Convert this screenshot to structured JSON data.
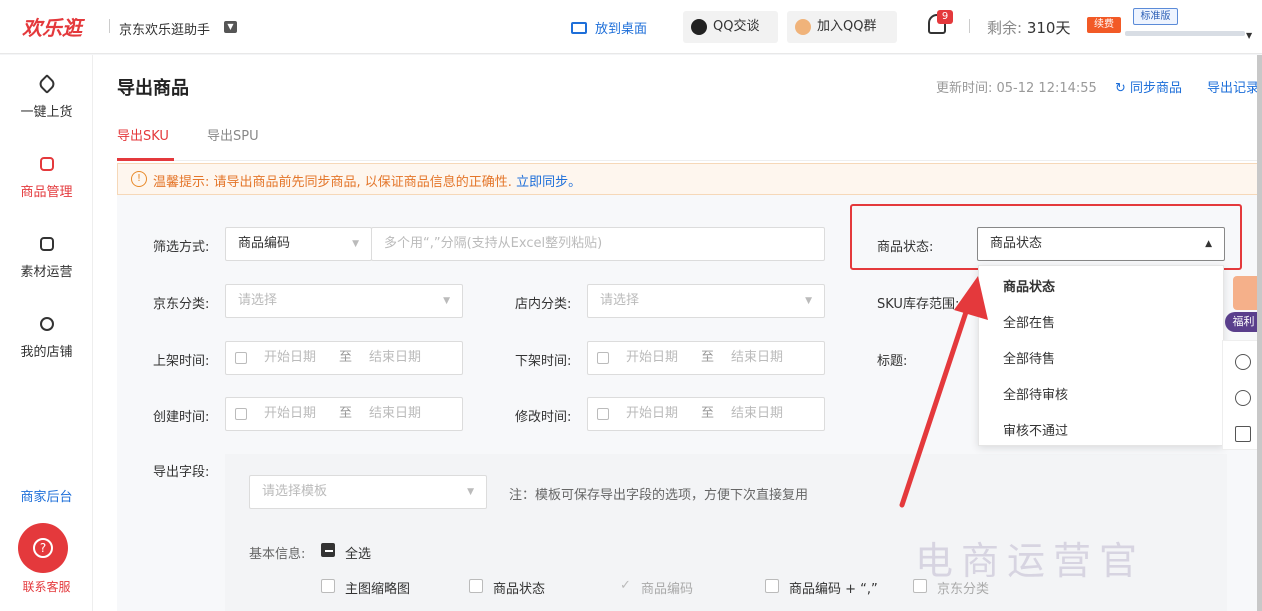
{
  "topbar": {
    "logo": "欢乐逛",
    "app_name": "京东欢乐逛助手",
    "send_to_desktop": "放到桌面",
    "qq_chat": "QQ交谈",
    "join_qq_group": "加入QQ群",
    "notification_count": "9",
    "remaining_label": "剩余:",
    "remaining_value": "310天",
    "renew_badge": "续费",
    "edition_badge": "标准版"
  },
  "sidebar": {
    "items": [
      {
        "label": "一键上货",
        "icon": "tag-icon"
      },
      {
        "label": "商品管理",
        "icon": "bag-icon",
        "active": true
      },
      {
        "label": "素材运营",
        "icon": "image-icon"
      },
      {
        "label": "我的店铺",
        "icon": "store-icon"
      }
    ],
    "merchant_backend": "商家后台",
    "customer_service": "联系客服"
  },
  "main": {
    "title": "导出商品",
    "updated_label": "更新时间: 05-12 12:14:55",
    "sync_link": "同步商品",
    "export_log_link": "导出记录",
    "tabs": [
      "导出SKU",
      "导出SPU"
    ],
    "notice_text": "温馨提示: 请导出商品前先同步商品, 以保证商品信息的正确性.",
    "notice_link": "立即同步。"
  },
  "filters": {
    "filter_method_label": "筛选方式:",
    "filter_method_value": "商品编码",
    "filter_input_placeholder": "多个用“,”分隔(支持从Excel整列粘贴)",
    "status_label": "商品状态:",
    "status_value": "商品状态",
    "jd_category_label": "京东分类:",
    "jd_category_placeholder": "请选择",
    "shop_category_label": "店内分类:",
    "shop_category_placeholder": "请选择",
    "sku_stock_label": "SKU库存范围:",
    "list_time_label": "上架时间:",
    "delist_time_label": "下架时间:",
    "title_label": "标题:",
    "create_time_label": "创建时间:",
    "modify_time_label": "修改时间:",
    "date_start": "开始日期",
    "date_to": "至",
    "date_end": "结束日期"
  },
  "status_dropdown": {
    "options": [
      "商品状态",
      "全部在售",
      "全部待售",
      "全部待审核",
      "审核不通过"
    ]
  },
  "export_fields": {
    "label": "导出字段:",
    "template_placeholder": "请选择模板",
    "template_note": "注：模板可保存导出字段的选项，方便下次直接复用",
    "basic_info_label": "基本信息:",
    "select_all": "全选",
    "fields": [
      "主图缩略图",
      "商品状态",
      "商品编码",
      "商品编码 + “,”",
      "京东分类"
    ]
  },
  "right_rail": {
    "welfare": "福利"
  },
  "watermark": "电商运营官",
  "colors": {
    "brand_red": "#e4393c",
    "link_blue": "#1e6fd9",
    "notice_orange": "#e4762a"
  }
}
